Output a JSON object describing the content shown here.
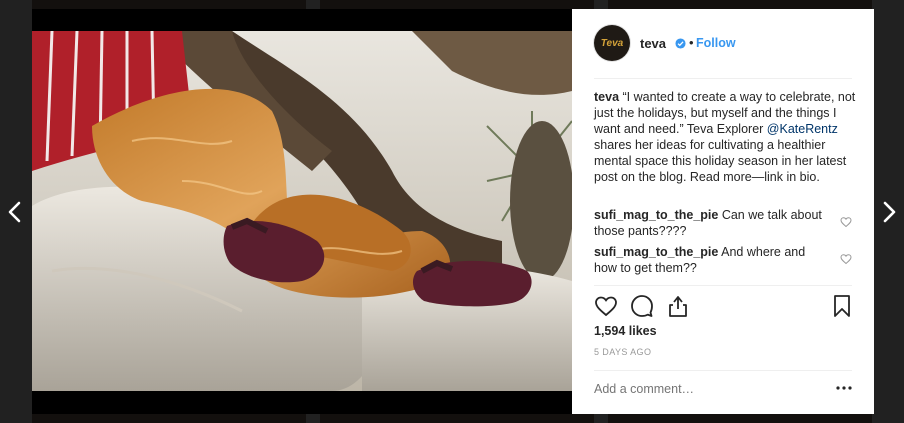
{
  "post": {
    "username": "teva",
    "avatar_text": "Teva",
    "separator": "•",
    "follow_label": "Follow",
    "caption_user": "teva",
    "caption_part1": " “I wanted to create a way to celebrate, not just the holidays, but myself and the things I want and need.” Teva Explorer ",
    "caption_mention": "@KateRentz",
    "caption_part2": " shares her ideas for cultivating a healthier mental space this holiday season in her latest post on the blog. Read more—link in bio.",
    "comments": [
      {
        "user": "sufi_mag_to_the_pie",
        "text": " Can we talk about those pants????"
      },
      {
        "user": "sufi_mag_to_the_pie",
        "text": " And where and how to get them??"
      }
    ],
    "likes": "1,594 likes",
    "time": "5 DAYS AGO",
    "comment_placeholder": "Add a comment…"
  },
  "icons": {
    "nav_prev": "chevron-left-icon",
    "nav_next": "chevron-right-icon",
    "verified": "verified-badge-icon",
    "like": "heart-icon",
    "comment": "comment-bubble-icon",
    "share": "share-icon",
    "save": "bookmark-icon",
    "more": "more-options-icon"
  },
  "colors": {
    "link": "#3897f0",
    "mention": "#003569",
    "muted": "#999999",
    "text": "#262626"
  }
}
